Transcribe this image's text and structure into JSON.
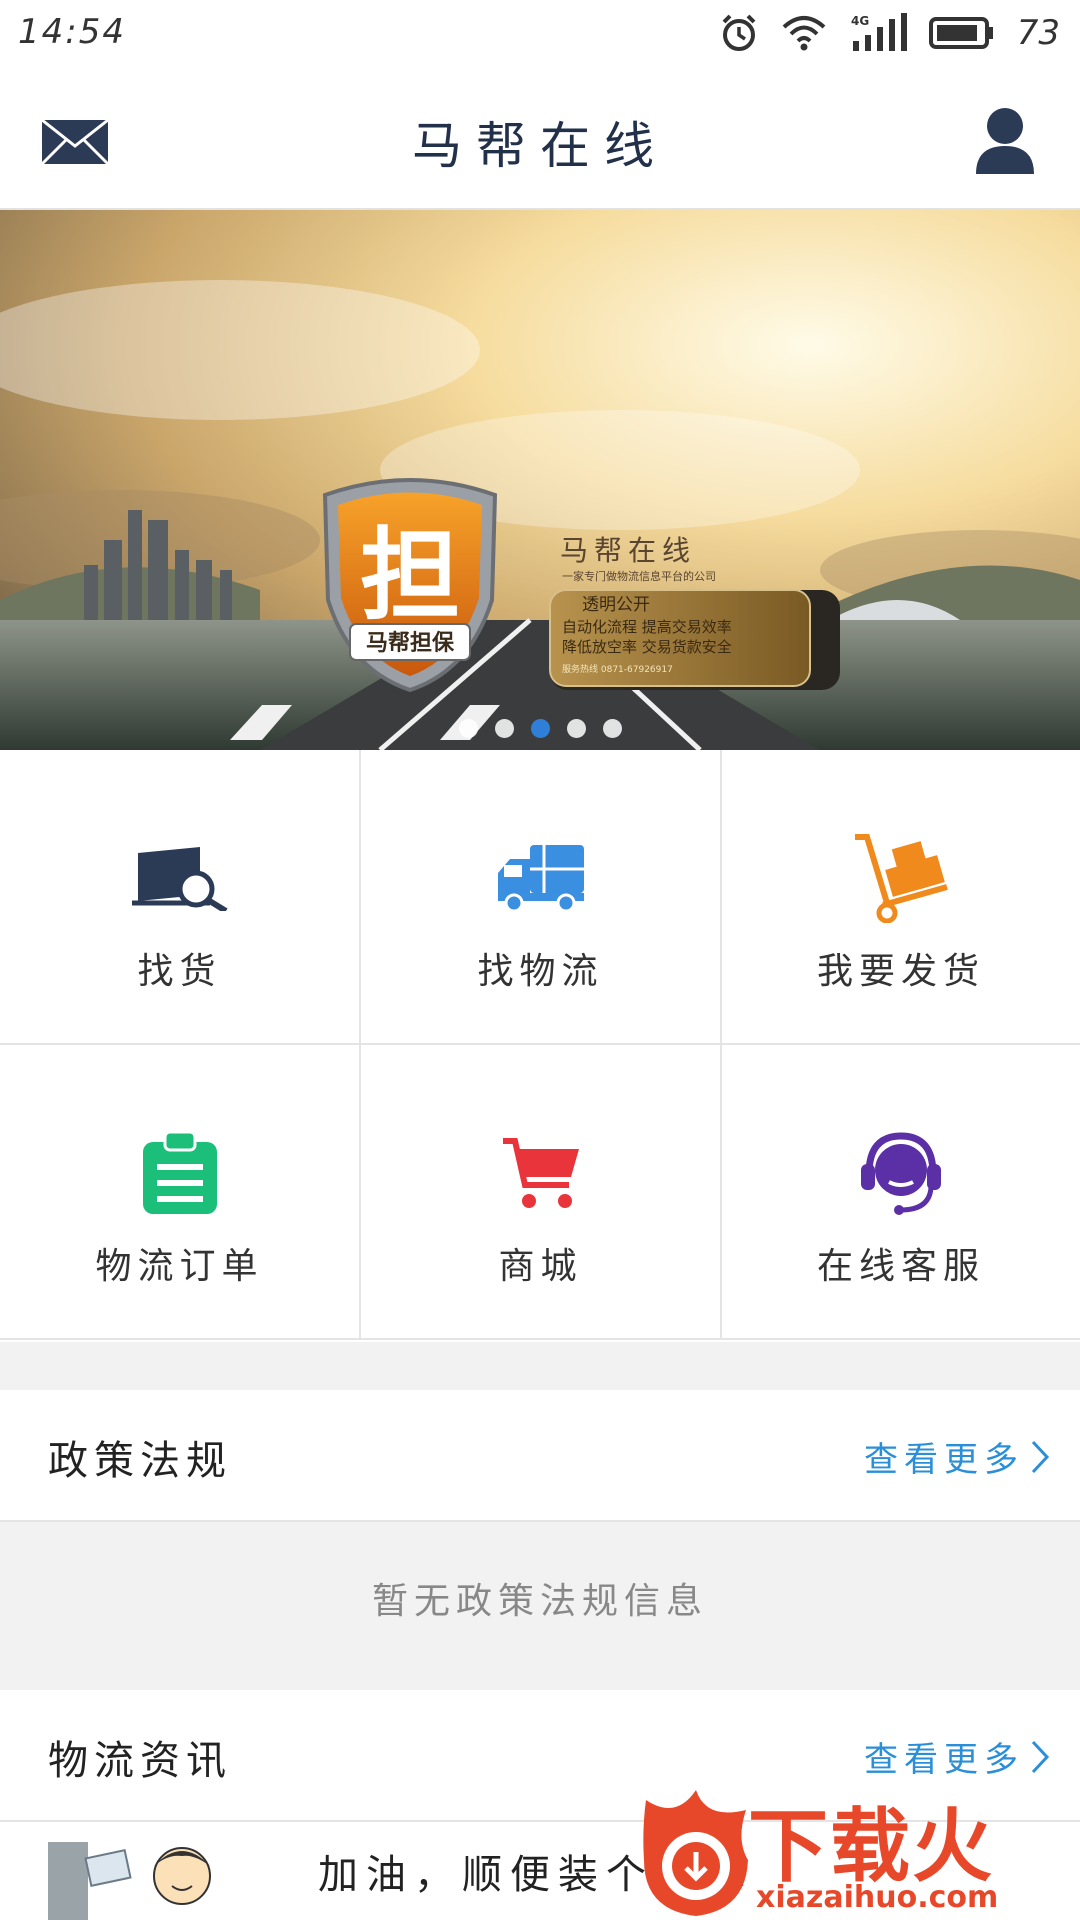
{
  "status_bar": {
    "time": "14:54",
    "battery": "73",
    "icons": [
      "alarm-icon",
      "wifi-icon",
      "signal-4g-icon",
      "battery-icon"
    ]
  },
  "header": {
    "title": "马帮在线",
    "left_icon": "mail-icon",
    "right_icon": "user-icon"
  },
  "banner": {
    "badge_text": "担",
    "badge_caption": "马帮担保",
    "brand": "马帮在线",
    "tagline": "一家专门做物流信息平台的公司",
    "box_title": "透明公开",
    "box_line1": "自动化流程  提高交易效率",
    "box_line2": "降低放空率  交易货款安全",
    "box_phone": "服务热线  0871-67926917",
    "slides": 5,
    "active_slide": 3
  },
  "grid": {
    "items": [
      {
        "label": "找货",
        "icon": "search-goods-icon",
        "color": "#2b3a55"
      },
      {
        "label": "找物流",
        "icon": "truck-icon",
        "color": "#3a8fe0"
      },
      {
        "label": "我要发货",
        "icon": "hand-truck-icon",
        "color": "#f08a1c"
      },
      {
        "label": "物流订单",
        "icon": "clipboard-icon",
        "color": "#1bbf7a"
      },
      {
        "label": "商城",
        "icon": "cart-icon",
        "color": "#e8343a"
      },
      {
        "label": "在线客服",
        "icon": "headset-icon",
        "color": "#5b2fa5"
      }
    ]
  },
  "policy": {
    "title": "政策法规",
    "more": "查看更多",
    "empty": "暂无政策法规信息"
  },
  "news": {
    "title": "物流资讯",
    "more": "查看更多",
    "items": [
      {
        "text": "加油，顺便装个ETC"
      }
    ]
  },
  "watermark": {
    "main": "下载火",
    "sub": "xiazaihuo.com"
  },
  "colors": {
    "accent": "#2a8fd8",
    "header_title": "#22304a",
    "watermark": "#e8482a"
  }
}
